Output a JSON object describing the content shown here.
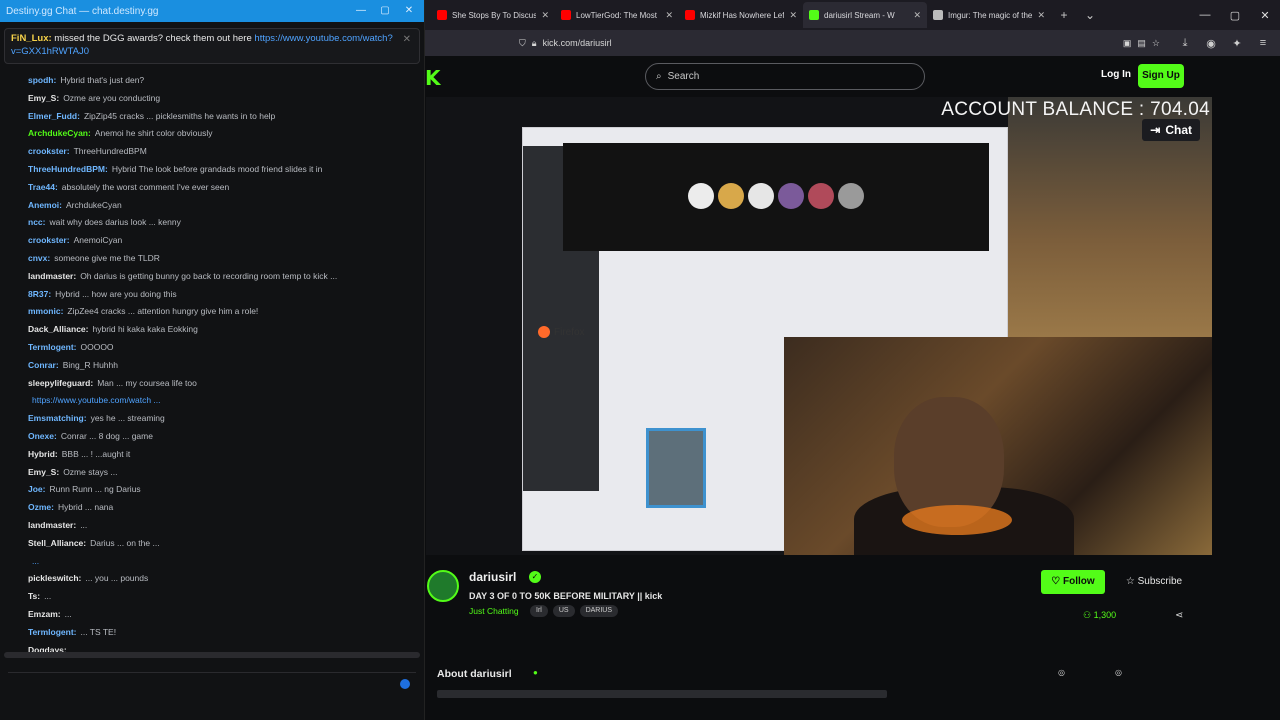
{
  "colors": {
    "kick_green": "#53fc18",
    "chat_titlebar": "#1a8fe0",
    "link_blue": "#4fa3ff"
  },
  "chat": {
    "title": "Destiny.gg Chat — chat.destiny.gg",
    "pinned": {
      "user": "FiN_Lux:",
      "text": "missed the DGG awards? check them out here",
      "link": "https://www.youtube.com/watch?v=GXX1hRWTAJ0"
    },
    "messages": [
      {
        "name": "spodh:",
        "color": "#6fb7ff",
        "text": "Hybrid that's just den?"
      },
      {
        "name": "Emy_S:",
        "color": "#e6e6e6",
        "text": "Ozme are you conducting"
      },
      {
        "name": "Elmer_Fudd:",
        "color": "#6fb7ff",
        "text": "ZipZip45 cracks ... picklesmiths he wants in to help"
      },
      {
        "name": "ArchdukeCyan:",
        "color": "#53fc18",
        "text": "Anemoi he shirt color obviously"
      },
      {
        "name": "crookster:",
        "color": "#6fb7ff",
        "text": "ThreeHundredBPM"
      },
      {
        "name": "ThreeHundredBPM:",
        "color": "#6fb7ff",
        "text": "Hybrid The look before grandads mood friend slides it in"
      },
      {
        "name": "Trae44:",
        "color": "#6fb7ff",
        "text": "absolutely the worst comment I've ever seen"
      },
      {
        "name": "Anemoi:",
        "color": "#6fb7ff",
        "text": "ArchdukeCyan"
      },
      {
        "name": "ncc:",
        "color": "#6fb7ff",
        "text": "wait why does darius look ... kenny"
      },
      {
        "name": "crookster:",
        "color": "#6fb7ff",
        "text": "AnemoiCyan"
      },
      {
        "name": "cnvx:",
        "color": "#6fb7ff",
        "text": "someone give me the TLDR"
      },
      {
        "name": "landmaster:",
        "color": "#e6e6e6",
        "text": "Oh darius is getting bunny go back to recording room temp to kick ..."
      },
      {
        "name": "8R37:",
        "color": "#6fb7ff",
        "text": "Hybrid ... how are you doing this"
      },
      {
        "name": "mmonic:",
        "color": "#6fb7ff",
        "text": "ZipZee4 cracks ... attention hungry give him a role!"
      },
      {
        "name": "Dack_Alliance:",
        "color": "#e6e6e6",
        "text": "hybrid hi kaka kaka Eokking"
      },
      {
        "name": "Termlogent:",
        "color": "#6fb7ff",
        "text": "OOOOO"
      },
      {
        "name": "Conrar:",
        "color": "#6fb7ff",
        "text": "Bing_R Huhhh"
      },
      {
        "name": "sleepylifeguard:",
        "color": "#e6e6e6",
        "text": "Man ... my coursea life too"
      },
      {
        "name": "",
        "color": "#4fa3ff",
        "text": "https://www.youtube.com/watch ..."
      },
      {
        "name": "Emsmatching:",
        "color": "#6fb7ff",
        "text": "yes he ... streaming"
      },
      {
        "name": "Onexe:",
        "color": "#6fb7ff",
        "text": "Conrar ... 8 dog ... game"
      },
      {
        "name": "Hybrid:",
        "color": "#e6e6e6",
        "text": "BBB ... ! ...aught it"
      },
      {
        "name": "Emy_S:",
        "color": "#e6e6e6",
        "text": "Ozme stays ..."
      },
      {
        "name": "Joe:",
        "color": "#6fb7ff",
        "text": "Runn Runn ... ng Darius"
      },
      {
        "name": "Ozme:",
        "color": "#6fb7ff",
        "text": "Hybrid ... nana"
      },
      {
        "name": "landmaster:",
        "color": "#e6e6e6",
        "text": "..."
      },
      {
        "name": "Stell_Alliance:",
        "color": "#e6e6e6",
        "text": "Darius ... on the ..."
      },
      {
        "name": "",
        "color": "#4fa3ff",
        "text": "..."
      },
      {
        "name": "pickleswitch:",
        "color": "#e6e6e6",
        "text": "... you ... pounds"
      },
      {
        "name": "Ts:",
        "color": "#e6e6e6",
        "text": "..."
      },
      {
        "name": "Emzam:",
        "color": "#e6e6e6",
        "text": "..."
      },
      {
        "name": "Termlogent:",
        "color": "#6fb7ff",
        "text": "... TS TE!"
      },
      {
        "name": "Dogdays:",
        "color": "#e6e6e6",
        "text": ""
      }
    ]
  },
  "browser": {
    "tabs": [
      {
        "label": "She Stops By To Discuss",
        "fav": "#ff0000",
        "active": false
      },
      {
        "label": "LowTierGod: The Most",
        "fav": "#ff0000",
        "active": false
      },
      {
        "label": "Mizkif Has Nowhere Left",
        "fav": "#ff0000",
        "active": false
      },
      {
        "label": "dariusirl Stream - W",
        "fav": "#53fc18",
        "active": true
      },
      {
        "label": "Imgur: The magic of the",
        "fav": "#bbbbbb",
        "active": false
      }
    ],
    "url": "kick.com/dariusirl"
  },
  "kick": {
    "logo": "K",
    "search_placeholder": "Search",
    "login": "Log In",
    "signup": "Sign Up",
    "overlay_balance": "ACCOUNT BALANCE : 704.04",
    "chat_toggle": "Chat",
    "screen_firefox": "Firefox",
    "channel": {
      "name": "dariusirl",
      "title": "DAY 3 OF 0 TO 50K BEFORE MILITARY || kick",
      "category": "Just Chatting",
      "tags": [
        "Irl",
        "US",
        "DARIUS"
      ],
      "follow": "Follow",
      "subscribe": "Subscribe",
      "viewers": "1,300"
    },
    "about": {
      "title": "About dariusirl"
    }
  }
}
